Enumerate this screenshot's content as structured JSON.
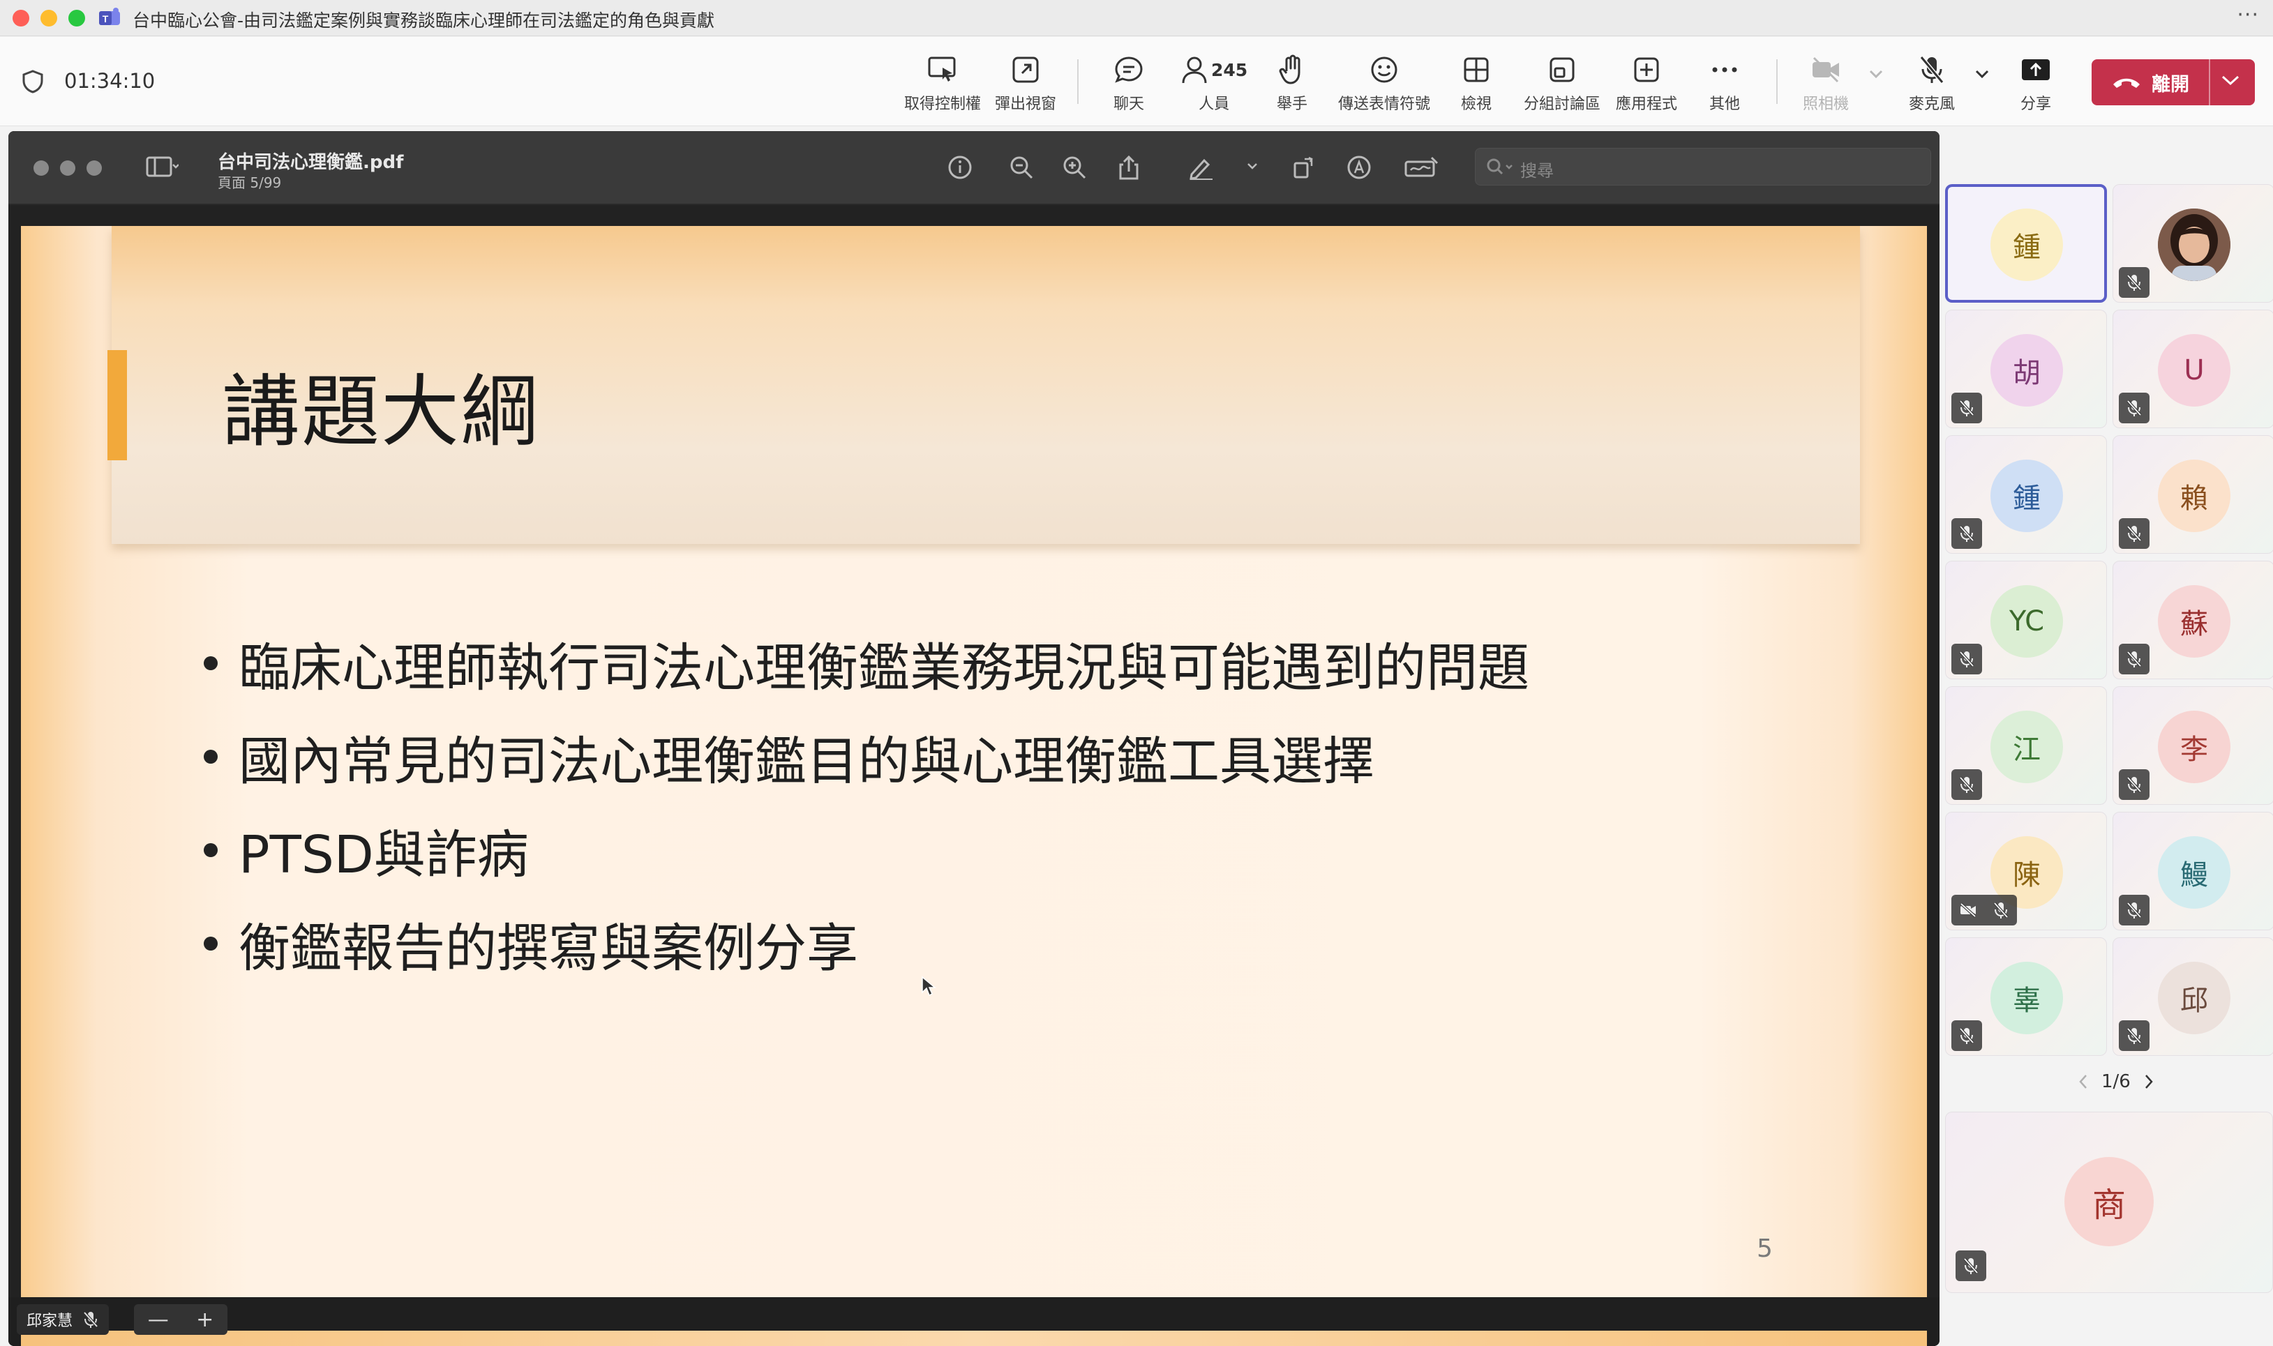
{
  "window": {
    "title": "台中臨心公會-由司法鑑定案例與實務談臨床心理師在司法鑑定的角色與貢獻",
    "menu": "···"
  },
  "meeting": {
    "timer": "01:34:10",
    "people_count": "245"
  },
  "toolbar": {
    "request_control": "取得控制權",
    "pop_out": "彈出視窗",
    "chat": "聊天",
    "people": "人員",
    "raise_hand": "舉手",
    "reactions": "傳送表情符號",
    "view": "檢視",
    "breakout_rooms": "分組討論區",
    "apps": "應用程式",
    "more": "其他",
    "camera": "照相機",
    "mic": "麥克風",
    "share": "分享",
    "leave": "離開"
  },
  "pdf": {
    "filename": "台中司法心理衡鑑.pdf",
    "page_info": "頁面 5/99",
    "search_placeholder": "搜尋"
  },
  "slide": {
    "title": "講題大綱",
    "bullets": [
      "臨床心理師執行司法心理衡鑑業務現況與可能遇到的問題",
      "國內常見的司法心理衡鑑目的與心理衡鑑工具選擇",
      "PTSD與詐病",
      "衡鑑報告的撰寫與案例分享"
    ],
    "number": "5"
  },
  "share_bottom": {
    "presenter_name": "邱家慧",
    "zoom_out": "—",
    "zoom_in": "+"
  },
  "participants": [
    {
      "initial": "鍾",
      "bg": "#fbefc6",
      "fg": "#8a6b12"
    },
    {
      "initial": "",
      "bg": "#6b4a3a",
      "fg": "#ffffff"
    },
    {
      "initial": "胡",
      "bg": "#f0d3ec",
      "fg": "#7d3a75"
    },
    {
      "initial": "U",
      "bg": "#f6d3dd",
      "fg": "#9c2f52"
    },
    {
      "initial": "鍾",
      "bg": "#cfdff5",
      "fg": "#2d5c99"
    },
    {
      "initial": "賴",
      "bg": "#fbe1cb",
      "fg": "#8a4f1e"
    },
    {
      "initial": "YC",
      "bg": "#dbeed3",
      "fg": "#3c6a2c"
    },
    {
      "initial": "蘇",
      "bg": "#f7d6d6",
      "fg": "#9a2f2f"
    },
    {
      "initial": "江",
      "bg": "#dcefd8",
      "fg": "#3f7a37"
    },
    {
      "initial": "李",
      "bg": "#f7d4d2",
      "fg": "#a33a33"
    },
    {
      "initial": "陳",
      "bg": "#fbe8c2",
      "fg": "#8b6412"
    },
    {
      "initial": "鰻",
      "bg": "#d2ecef",
      "fg": "#2a6b74"
    },
    {
      "initial": "辜",
      "bg": "#d2efde",
      "fg": "#2e7049"
    },
    {
      "initial": "邱",
      "bg": "#ece1dc",
      "fg": "#6b4b3e"
    }
  ],
  "pager": {
    "text": "1/6"
  },
  "spotlight": {
    "initial": "商",
    "bg": "#f8d5d2",
    "fg": "#a3352f"
  },
  "colors": {
    "accent": "#5b5fc7",
    "leave": "#c4314b",
    "slide_accent": "#f2a93b"
  }
}
